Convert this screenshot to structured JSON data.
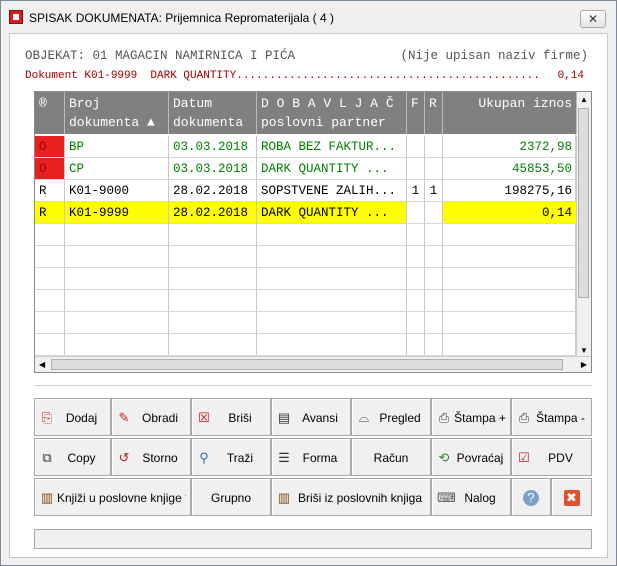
{
  "window": {
    "title": "SPISAK DOKUMENATA:  Prijemnica Repromaterijala  ( 4 )",
    "close_label": "✕"
  },
  "header": {
    "object_line": "OBJEKAT: 01 MAGACIN NAMIRNICA I PIĆA",
    "firm_note": "(Nije upisan naziv firme)",
    "document_line": "Dokument K01-9999  DARK QUANTITY..............................................",
    "document_value": "0,14"
  },
  "grid": {
    "columns": [
      {
        "l1": "®",
        "l2": ""
      },
      {
        "l1": "Broj",
        "l2": "dokumenta ▲"
      },
      {
        "l1": "Datum",
        "l2": "dokumenta"
      },
      {
        "l1": "D O B A V L J A Č",
        "l2": "poslovni partner"
      },
      {
        "l1": "F",
        "l2": ""
      },
      {
        "l1": "R",
        "l2": ""
      },
      {
        "l1": "Ukupan iznos",
        "l2": ""
      }
    ],
    "rows": [
      {
        "mark": "O",
        "broj": "BP",
        "datum": "03.03.2018",
        "dobavljac": "ROBA BEZ FAKTUR...",
        "f": "",
        "r": "",
        "iznos": "2372,98",
        "style": "green"
      },
      {
        "mark": "O",
        "broj": "CP",
        "datum": "03.03.2018",
        "dobavljac": "DARK QUANTITY   ...",
        "f": "",
        "r": "",
        "iznos": "45853,50",
        "style": "green"
      },
      {
        "mark": "R",
        "broj": "K01-9000",
        "datum": "28.02.2018",
        "dobavljac": "SOPSTVENE ZALIH...",
        "f": "1",
        "r": "1",
        "iznos": "198275,16",
        "style": "normal"
      },
      {
        "mark": "R",
        "broj": "K01-9999",
        "datum": "28.02.2018",
        "dobavljac": "DARK QUANTITY   ...",
        "f": "",
        "r": "",
        "iznos": "0,14",
        "style": "selected"
      }
    ]
  },
  "toolbar": {
    "row1": [
      {
        "label": "Dodaj",
        "icon": "add-doc-icon"
      },
      {
        "label": "Obradi",
        "icon": "edit-icon"
      },
      {
        "label": "Briši",
        "icon": "delete-icon"
      },
      {
        "label": "Avansi",
        "icon": "doc-icon"
      },
      {
        "label": "Pregled",
        "icon": "glasses-icon"
      },
      {
        "label": "Štampa +",
        "icon": "printer-icon"
      },
      {
        "label": "Štampa -",
        "icon": "printer-icon"
      }
    ],
    "row2": [
      {
        "label": "Copy",
        "icon": "copy-icon"
      },
      {
        "label": "Storno",
        "icon": "storno-icon"
      },
      {
        "label": "Traži",
        "icon": "search-icon"
      },
      {
        "label": "Forma",
        "icon": "form-icon"
      },
      {
        "label": "Račun",
        "icon": ""
      },
      {
        "label": "Povraćaj",
        "icon": "return-icon"
      },
      {
        "label": "PDV",
        "icon": "check-icon"
      }
    ],
    "row3": [
      {
        "label": "Knjiži u poslovne knjige *",
        "icon": "book-icon"
      },
      {
        "label": "Grupno",
        "icon": ""
      },
      {
        "label": "Briši iz poslovnih knjiga",
        "icon": "book-icon"
      },
      {
        "label": "Nalog",
        "icon": "keyboard-icon"
      },
      {
        "label": "",
        "icon": "help-icon"
      },
      {
        "label": "",
        "icon": "close-icon"
      }
    ]
  },
  "colors": {
    "header_bg": "#808080",
    "mark_red": "#e82020",
    "green_text": "#008000",
    "selected": "#ffff00",
    "doc_red": "#a00000"
  }
}
